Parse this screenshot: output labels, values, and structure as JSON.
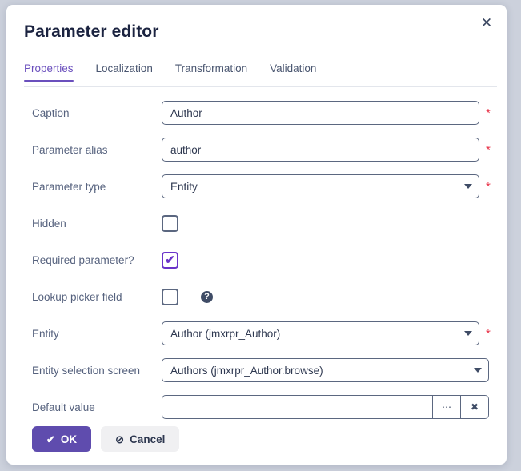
{
  "dialog": {
    "title": "Parameter editor",
    "close_label": "✕"
  },
  "tabs": [
    {
      "label": "Properties",
      "active": true
    },
    {
      "label": "Localization",
      "active": false
    },
    {
      "label": "Transformation",
      "active": false
    },
    {
      "label": "Validation",
      "active": false
    }
  ],
  "fields": {
    "caption": {
      "label": "Caption",
      "value": "Author",
      "required_marker": "*"
    },
    "alias": {
      "label": "Parameter alias",
      "value": "author",
      "required_marker": "*"
    },
    "type": {
      "label": "Parameter type",
      "value": "Entity",
      "required_marker": "*"
    },
    "hidden": {
      "label": "Hidden",
      "checked": false,
      "check_glyph": "✔"
    },
    "required": {
      "label": "Required parameter?",
      "checked": true,
      "check_glyph": "✔"
    },
    "lookup": {
      "label": "Lookup picker field",
      "checked": false,
      "check_glyph": "✔",
      "help_glyph": "?"
    },
    "entity": {
      "label": "Entity",
      "value": "Author (jmxrpr_Author)",
      "required_marker": "*"
    },
    "selection_screen": {
      "label": "Entity selection screen",
      "value": "Authors (jmxrpr_Author.browse)"
    },
    "default_value": {
      "label": "Default value",
      "value": "",
      "placeholder": "",
      "pick_label": "⋯",
      "clear_label": "✖"
    }
  },
  "footer": {
    "ok_label": "OK",
    "ok_icon": "✔",
    "cancel_label": "Cancel",
    "cancel_icon": "⊘"
  },
  "colors": {
    "accent_purple": "#5f4cae",
    "tab_active": "#6a4fbd",
    "checkbox_checked": "#6a33c9",
    "required_red": "#e8354a",
    "title_navy": "#1b2340",
    "page_background": "#ccd1dc"
  }
}
